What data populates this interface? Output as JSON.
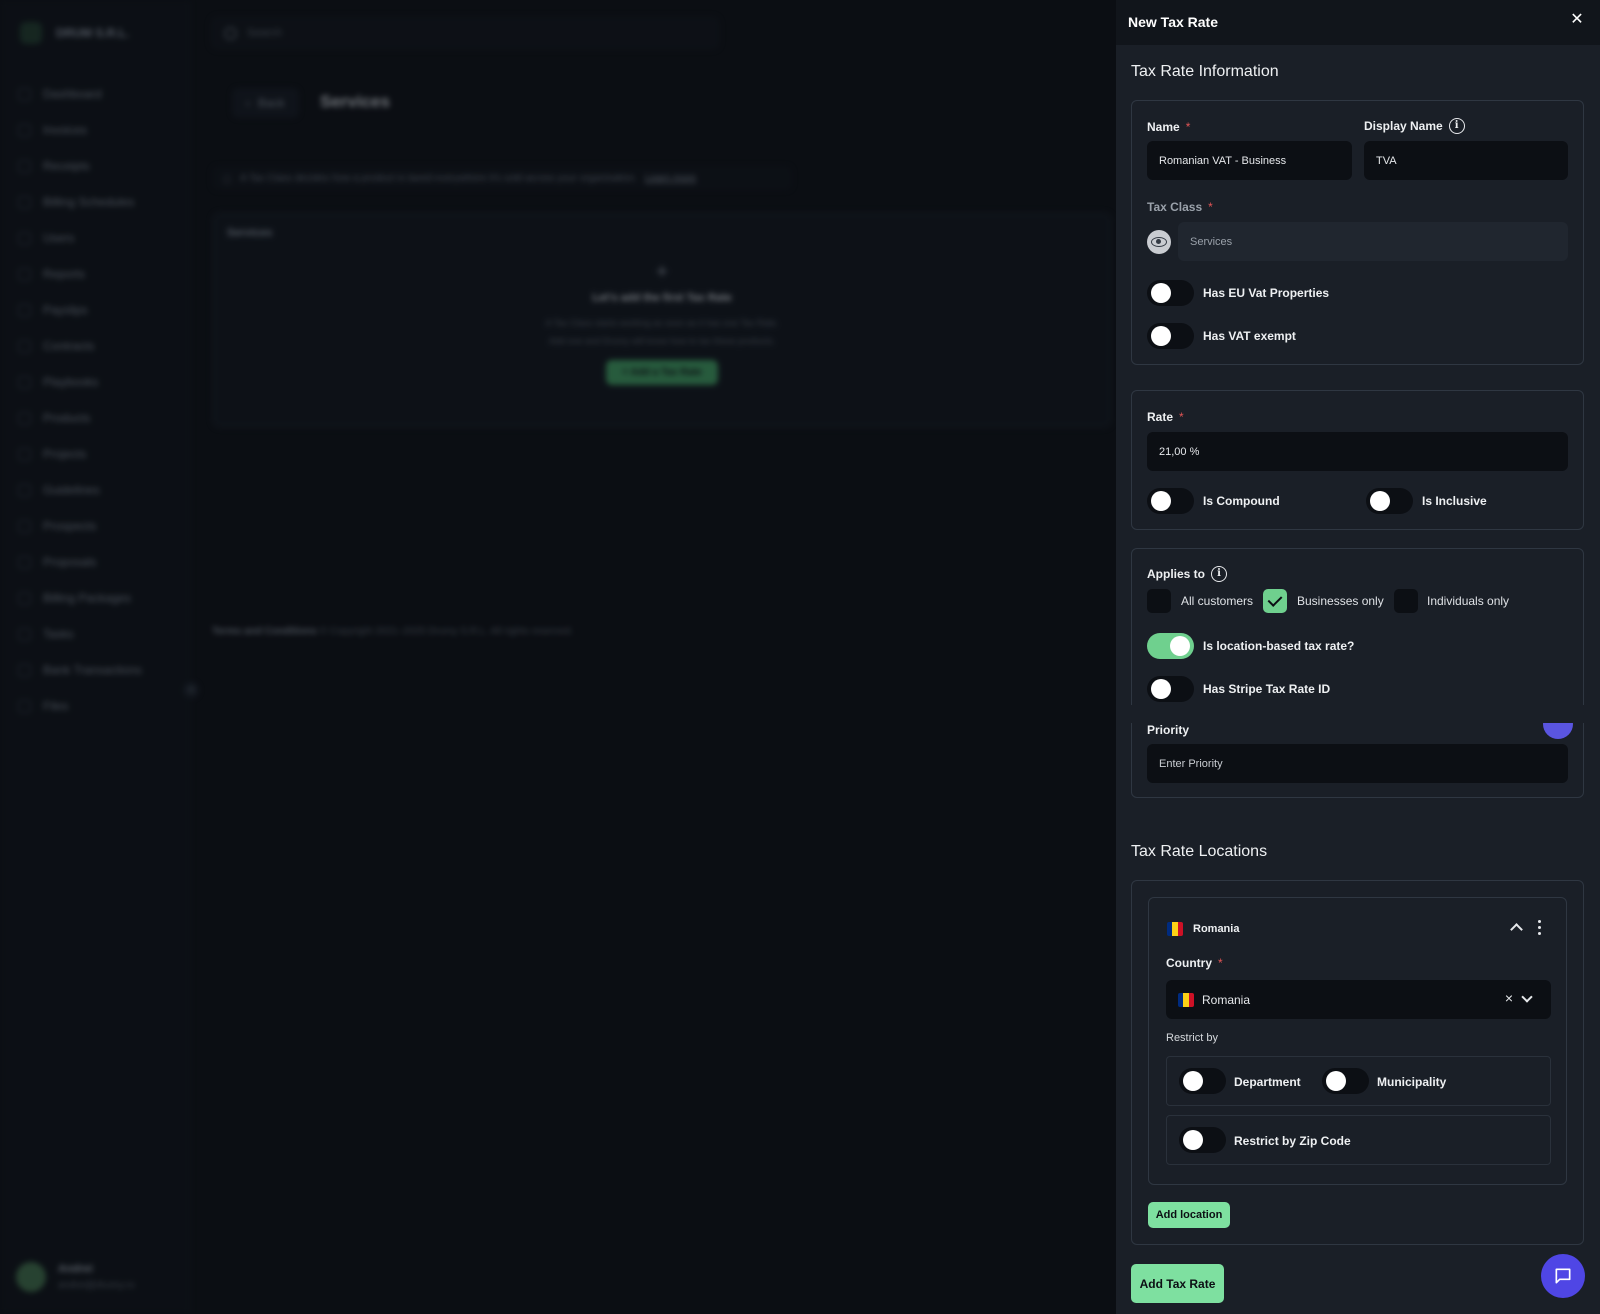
{
  "background": {
    "brand_name": "DRUM S.R.L.",
    "search_placeholder": "Search",
    "nav": [
      "Dashboard",
      "Invoices",
      "Receipts",
      "Billing Schedules",
      "Users",
      "Reports",
      "Payslips",
      "Contracts",
      "Playbooks",
      "Products",
      "Projects",
      "Guidelines",
      "Prospects",
      "Proposals",
      "Billing Packages",
      "Tasks",
      "Bank Transactions",
      "Files"
    ],
    "back_label": "Back",
    "page_title": "Services",
    "info_text": "A Tax Class decides how a product is taxed everywhere it's sold across your organisation.",
    "info_link": "Learn more",
    "card_header": "Services",
    "empty_title": "Let's add the first Tax Rate",
    "empty_text_1": "A Tax Class starts working as soon as it has one Tax Rate.",
    "empty_text_2": "Add one and Drumy will know how to tax these products.",
    "empty_button": "+ Add a Tax Rate",
    "footer_link": "Terms and Conditions",
    "footer_text": "© Copyright 2021–2025 Drumy S.R.L. All rights reserved.",
    "user_name": "Andrei",
    "user_email": "andrei@drumy.ro"
  },
  "drawer": {
    "title": "New Tax Rate",
    "info_section": {
      "title": "Tax Rate Information",
      "name_label": "Name",
      "name_value": "Romanian VAT - Business",
      "display_name_label": "Display Name",
      "display_name_value": "TVA",
      "tax_class_label": "Tax Class",
      "tax_class_value": "Services",
      "eu_vat_label": "Has EU Vat Properties",
      "vat_exempt_label": "Has VAT exempt"
    },
    "rate_section": {
      "rate_label": "Rate",
      "rate_value": "21,00 %",
      "compound_label": "Is Compound",
      "inclusive_label": "Is Inclusive"
    },
    "applies_section": {
      "label": "Applies to",
      "options": [
        {
          "label": "All customers",
          "checked": false
        },
        {
          "label": "Businesses only",
          "checked": true
        },
        {
          "label": "Individuals only",
          "checked": false
        }
      ],
      "location_based_label": "Is location-based tax rate?",
      "location_based_on": true,
      "stripe_label": "Has Stripe Tax Rate ID",
      "priority_label": "Priority",
      "priority_placeholder": "Enter Priority"
    },
    "locations_section": {
      "title": "Tax Rate Locations",
      "location": {
        "name": "Romania",
        "country_label": "Country",
        "country_value": "Romania",
        "clear_icon": "×",
        "restrict_by_label": "Restrict by",
        "department_label": "Department",
        "municipality_label": "Municipality",
        "zip_label": "Restrict by Zip Code"
      },
      "add_location_label": "Add location"
    },
    "submit_label": "Add Tax Rate",
    "close_icon": "✕"
  },
  "colors": {
    "accent_green": "#7ee0a0",
    "toggle_on": "#6fd08e",
    "chat_button": "#4f46e5",
    "flag_blue": "#002b7f",
    "flag_yellow": "#fcd116",
    "flag_red": "#ce1126"
  }
}
